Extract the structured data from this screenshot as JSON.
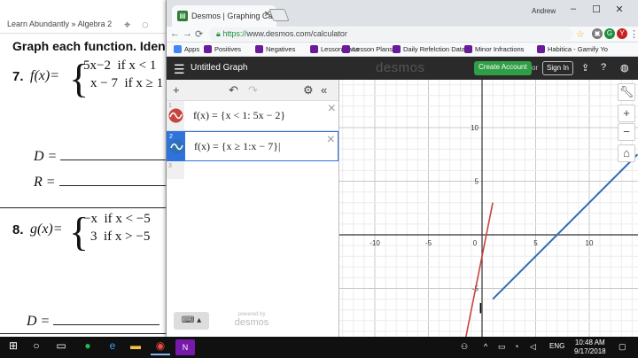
{
  "doc": {
    "title": "Learn Abundantly » Algebra 2",
    "header": "Graph each function.  Iden",
    "p7": {
      "num": "7.",
      "lhs": "f(x)=",
      "c1_expr": "5x−2",
      "c1_cond": "if x < 1",
      "c2_expr": "x − 7",
      "c2_cond": "if x ≥ 1"
    },
    "domain_label": "D =",
    "range_label": "R =",
    "p8": {
      "num": "8.",
      "lhs": "g(x)=",
      "c1_expr": "−x",
      "c1_cond": "if x < −5",
      "c2_expr": "3",
      "c2_cond": "if x > −5"
    },
    "domain8_label": "D ="
  },
  "browser": {
    "tab_title": "Desmos | Graphing Calcul",
    "profile": "Andrew",
    "url_secure": "https://",
    "url_rest": "www.desmos.com/calculator",
    "bookmarks": [
      {
        "label": "Apps",
        "color": "#4285f4"
      },
      {
        "label": "Positives",
        "color": "#6a1b9a"
      },
      {
        "label": "Negatives",
        "color": "#6a1b9a"
      },
      {
        "label": "LessonPlans",
        "color": "#6a1b9a"
      },
      {
        "label": "Lesson Plans",
        "color": "#6a1b9a"
      },
      {
        "label": "Daily Refelction Data",
        "color": "#6a1b9a"
      },
      {
        "label": "Minor Infractions",
        "color": "#6a1b9a"
      },
      {
        "label": "Habitica - Gamify Yo",
        "color": "#6a1b9a"
      }
    ]
  },
  "desmos": {
    "graph_title": "Untitled Graph",
    "logo": "desmos",
    "create_account": "Create Account",
    "or": "or",
    "sign_in": "Sign In",
    "expressions": [
      {
        "num": "1",
        "text": "f(x) = {x < 1: 5x − 2}",
        "color": "#c74440"
      },
      {
        "num": "2",
        "text": "f(x) = {x ≥ 1:x − 7}|",
        "color": "#2d70b3"
      }
    ],
    "blank_num": "3",
    "powered_by": "powered by",
    "powered_logo": "desmos",
    "x_ticks": [
      "-10",
      "-5",
      "0",
      "5",
      "10"
    ],
    "y_ticks": [
      "10",
      "5",
      "-5"
    ]
  },
  "taskbar": {
    "lang": "ENG",
    "time": "10:48 AM",
    "date": "9/17/2018"
  }
}
